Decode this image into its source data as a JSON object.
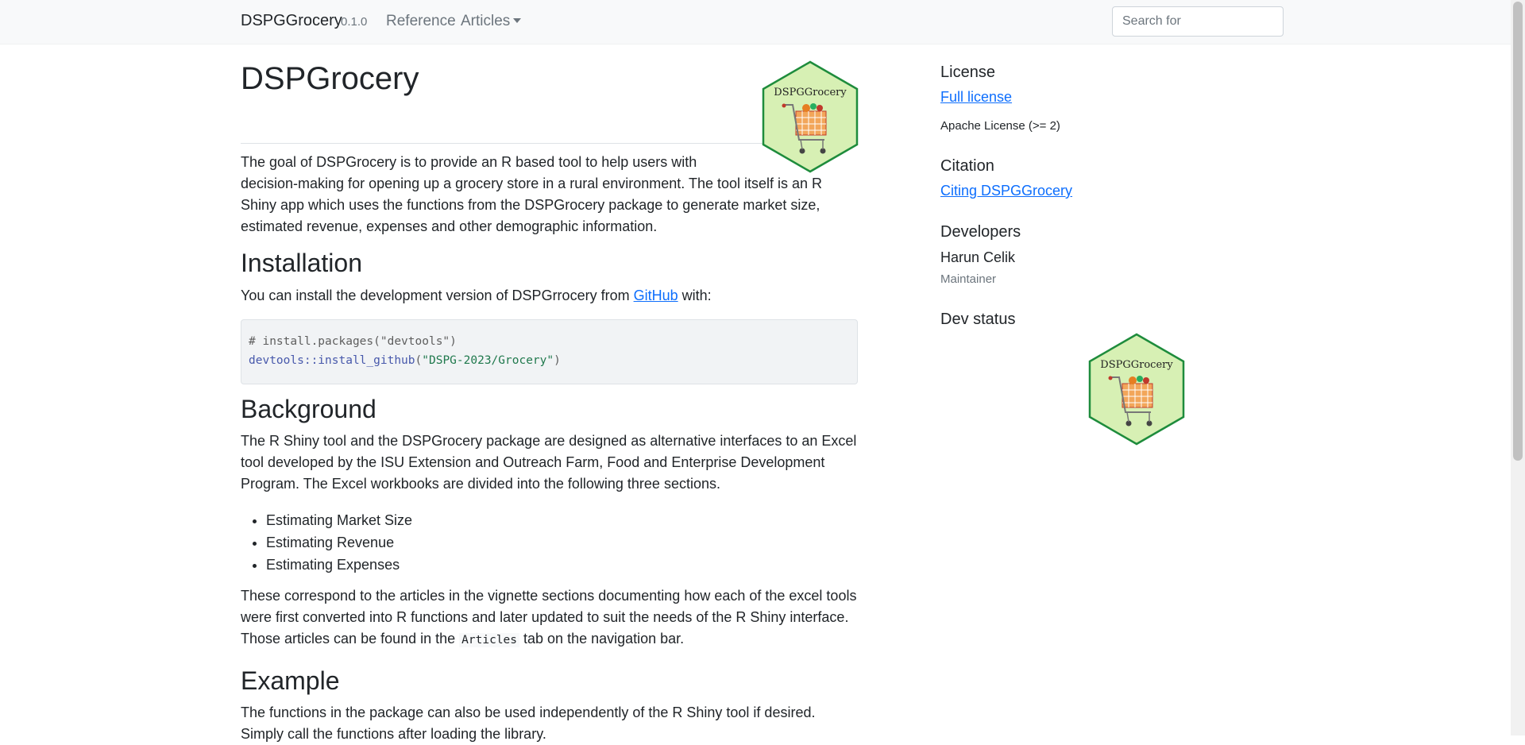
{
  "navbar": {
    "brand": "DSPGGrocery",
    "version": "0.1.0",
    "reference": "Reference",
    "articles": "Articles",
    "search_placeholder": "Search for"
  },
  "main": {
    "title": "DSPGrocery",
    "logo_text": "DSPGGrocery",
    "goal_line1": "The goal of DSPGrocery is to provide an R based tool to help users with",
    "goal_rest": "decision-making for opening up a grocery store in a rural environment. The tool itself is an R Shiny app which uses the functions from the DSPGrocery package to generate market size, estimated revenue, expenses and other demographic information.",
    "install_heading": "Installation",
    "install_text_before": "You can install the development version of DSPGrrocery from ",
    "install_link": "GitHub",
    "install_text_after": " with:",
    "code_line1": "# install.packages(\"devtools\")",
    "code_fn": "devtools::install_github",
    "code_open": "(",
    "code_str": "\"DSPG-2023/Grocery\"",
    "code_close": ")",
    "background_heading": "Background",
    "background_text": "The R Shiny tool and the DSPGrocery package are designed as alternative interfaces to an Excel tool developed by the ISU Extension and Outreach Farm, Food and Enterprise Development Program. The Excel workbooks are divided into the following three sections.",
    "sections": [
      "Estimating Market Size",
      "Estimating Revenue",
      "Estimating Expenses"
    ],
    "vignette_before": "These correspond to the articles in the vignette sections documenting how each of the excel tools were first converted into R functions and later updated to suit the needs of the R Shiny interface. Those articles can be found in the ",
    "vignette_code": "Articles",
    "vignette_after": " tab on the navigation bar.",
    "example_heading": "Example",
    "example_text": "The functions in the package can also be used independently of the R Shiny tool if desired.",
    "example_text2": "Simply call the functions after loading the library."
  },
  "sidebar": {
    "license_heading": "License",
    "license_link": "Full license",
    "license_text": "Apache License (>= 2)",
    "citation_heading": "Citation",
    "citation_link": "Citing DSPGGrocery",
    "developers_heading": "Developers",
    "developer_name": "Harun Celik",
    "developer_role": "Maintainer",
    "devstatus_heading": "Dev status",
    "logo_text": "DSPGGrocery"
  },
  "colors": {
    "link": "#0d6efd",
    "hex_border": "#1e8c3c",
    "hex_fill": "#d7f0b4",
    "navbar_bg": "#f8f9fa"
  }
}
